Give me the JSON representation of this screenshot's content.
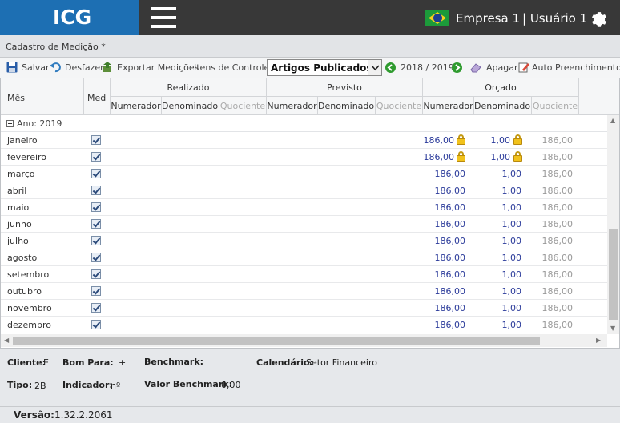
{
  "header": {
    "logo": "ICG",
    "company": "Empresa 1",
    "user": "| Usuário 1"
  },
  "page": {
    "title": "Cadastro de Medição *"
  },
  "toolbar": {
    "save_label": "Salvar",
    "undo_label": "Desfazer",
    "export_label": "Exportar Medições",
    "control_items_label": "Itens de Controle:",
    "control_items_value": "Artigos Publicados",
    "period": "2018 / 2019",
    "delete_label": "Apagar",
    "autofill_label": "Auto Preenchimento"
  },
  "grid": {
    "col_month": "Mês",
    "col_med": "Med",
    "groups": [
      "Realizado",
      "Previsto",
      "Orçado"
    ],
    "subcols": [
      "Numerador",
      "Denominador",
      "Quociente"
    ],
    "group_label": "Ano: 2019",
    "rows": [
      {
        "month": "janeiro",
        "numerador": "186,00",
        "denominador": "1,00",
        "quociente": "186,00",
        "locked": true
      },
      {
        "month": "fevereiro",
        "numerador": "186,00",
        "denominador": "1,00",
        "quociente": "186,00",
        "locked": true
      },
      {
        "month": "março",
        "numerador": "186,00",
        "denominador": "1,00",
        "quociente": "186,00",
        "locked": false
      },
      {
        "month": "abril",
        "numerador": "186,00",
        "denominador": "1,00",
        "quociente": "186,00",
        "locked": false
      },
      {
        "month": "maio",
        "numerador": "186,00",
        "denominador": "1,00",
        "quociente": "186,00",
        "locked": false
      },
      {
        "month": "junho",
        "numerador": "186,00",
        "denominador": "1,00",
        "quociente": "186,00",
        "locked": false
      },
      {
        "month": "julho",
        "numerador": "186,00",
        "denominador": "1,00",
        "quociente": "186,00",
        "locked": false
      },
      {
        "month": "agosto",
        "numerador": "186,00",
        "denominador": "1,00",
        "quociente": "186,00",
        "locked": false
      },
      {
        "month": "setembro",
        "numerador": "186,00",
        "denominador": "1,00",
        "quociente": "186,00",
        "locked": false
      },
      {
        "month": "outubro",
        "numerador": "186,00",
        "denominador": "1,00",
        "quociente": "186,00",
        "locked": false
      },
      {
        "month": "novembro",
        "numerador": "186,00",
        "denominador": "1,00",
        "quociente": "186,00",
        "locked": false
      },
      {
        "month": "dezembro",
        "numerador": "186,00",
        "denominador": "1,00",
        "quociente": "186,00",
        "locked": false
      }
    ]
  },
  "footer": {
    "cliente_label": "Cliente:",
    "cliente_value": "E",
    "bom_para_label": "Bom Para:",
    "bom_para_value": "+",
    "benchmark_label": "Benchmark:",
    "calendario_label": "Calendário:",
    "calendario_value": "Setor Financeiro",
    "tipo_label": "Tipo:",
    "tipo_value": "2B",
    "indicador_label": "Indicador:",
    "indicador_value": "nº",
    "valor_benchmark_label": "Valor Benchmark:",
    "valor_benchmark_value": "0,00",
    "versao_label": "Versão:",
    "versao_value": "1.32.2.2061"
  },
  "colors": {
    "brand": "#1d6fb3",
    "topbar": "#383838",
    "value_text": "#2a3a9a"
  },
  "icons": {
    "save": "floppy-disk-icon",
    "undo": "undo-icon",
    "export": "export-icon",
    "prev": "arrow-left-circle-icon",
    "next": "arrow-right-circle-icon",
    "delete": "eraser-icon",
    "autofill": "edit-icon",
    "settings": "gear-icon",
    "menu": "hamburger-icon",
    "lock": "lock-icon"
  }
}
